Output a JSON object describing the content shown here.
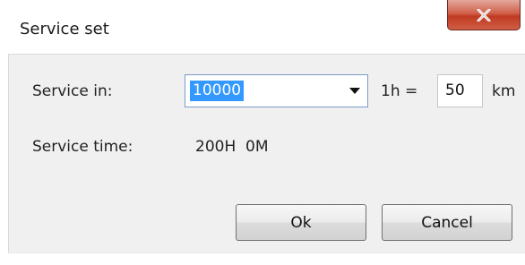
{
  "window": {
    "title": "Service set",
    "close_icon": "close-x-icon"
  },
  "service_in": {
    "label": "Service in:",
    "selected_value": "10000",
    "dropdown_icon": "dropdown-arrow-icon"
  },
  "ratio": {
    "prefix": "1h =",
    "value": "50",
    "unit": "km"
  },
  "service_time": {
    "label": "Service time:",
    "value": "200H  0M"
  },
  "buttons": {
    "ok_label": "Ok",
    "cancel_label": "Cancel"
  },
  "colors": {
    "selection": "#3399ff",
    "close_button": "#c03a22",
    "panel_background": "#f0f0f0"
  }
}
